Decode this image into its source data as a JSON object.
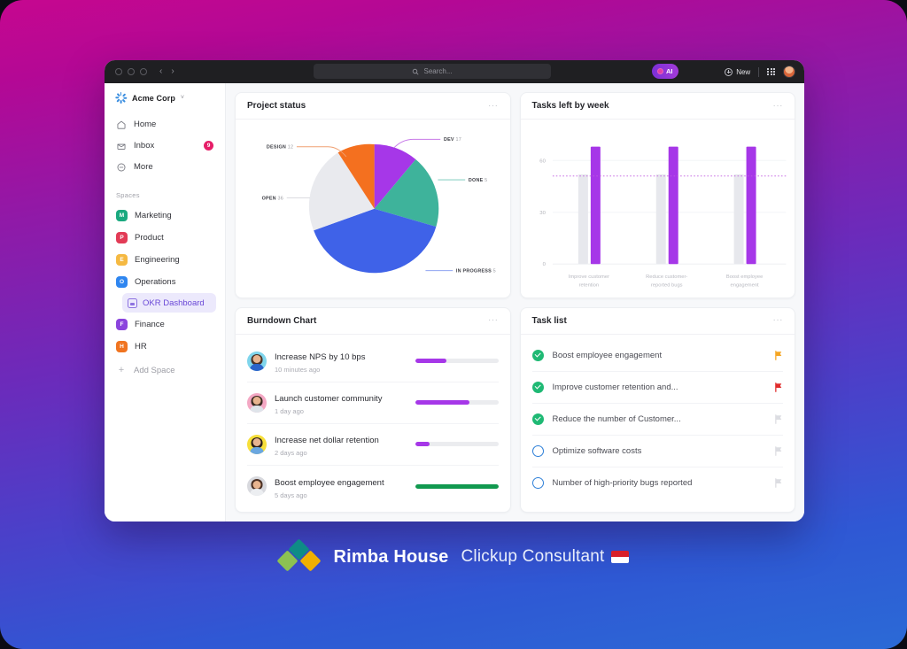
{
  "theme": {
    "bg_top": "#c6078f",
    "bg_mid": "#6b2bbb",
    "bg_bottom": "#2b6ad6",
    "accent_purple": "#a637e8",
    "accent_green": "#1fb974"
  },
  "titlebar": {
    "back_glyph": "‹",
    "forward_glyph": "›",
    "search_placeholder": "Search...",
    "ai_label": "AI",
    "new_label": "New"
  },
  "sidebar": {
    "workspace": "Acme Corp",
    "workspace_caret": "˅",
    "nav": [
      {
        "label": "Home",
        "icon": "home-icon",
        "badge": ""
      },
      {
        "label": "Inbox",
        "icon": "inbox-icon",
        "badge": "9"
      },
      {
        "label": "More",
        "icon": "more-icon",
        "badge": ""
      }
    ],
    "spaces_heading": "Spaces",
    "spaces": [
      {
        "label": "Marketing",
        "initial": "M",
        "color": "#1aa97f"
      },
      {
        "label": "Product",
        "initial": "P",
        "color": "#e23b56"
      },
      {
        "label": "Engineering",
        "initial": "E",
        "color": "#f5b942"
      },
      {
        "label": "Operations",
        "initial": "O",
        "color": "#2f86f0"
      }
    ],
    "sub_item": {
      "label": "OKR Dashboard",
      "icon": "dashboard-icon"
    },
    "spaces_rest": [
      {
        "label": "Finance",
        "initial": "F",
        "color": "#8b44dd"
      },
      {
        "label": "HR",
        "initial": "H",
        "color": "#f07420"
      }
    ],
    "add_space": "Add Space"
  },
  "cards": {
    "project_status": {
      "title": "Project status",
      "menu": "···"
    },
    "tasks_left": {
      "title": "Tasks left by week",
      "menu": "···"
    },
    "burndown": {
      "title": "Burndown Chart",
      "menu": "···"
    },
    "task_list": {
      "title": "Task list",
      "menu": "···"
    }
  },
  "chart_data": [
    {
      "type": "pie",
      "title": "Project status",
      "categories": [
        "DEV",
        "DONE",
        "IN PROGRESS",
        "OPEN",
        "DESIGN"
      ],
      "values": [
        17,
        5,
        5,
        36,
        12
      ],
      "slice_fractions": [
        0.14,
        0.155,
        0.4,
        0.21,
        0.095
      ],
      "colors": [
        "#a637e8",
        "#3eb39b",
        "#3f62e8",
        "#e9eaee",
        "#f4701f"
      ],
      "labels": [
        {
          "name": "DEV",
          "value": "17"
        },
        {
          "name": "DONE",
          "value": "5"
        },
        {
          "name": "IN PROGRESS",
          "value": "5"
        },
        {
          "name": "OPEN",
          "value": "36"
        },
        {
          "name": "DESIGN",
          "value": "12"
        }
      ]
    },
    {
      "type": "bar",
      "title": "Tasks left by week",
      "categories": [
        "Improve customer retention",
        "Reduce customer-reported bugs",
        "Boost employee engagement"
      ],
      "series": [
        {
          "name": "previous",
          "values": [
            52,
            52,
            52
          ],
          "color": "#e7e8ed"
        },
        {
          "name": "current",
          "values": [
            68,
            68,
            68
          ],
          "color": "#a637e8"
        }
      ],
      "ylim": [
        0,
        75
      ],
      "yticks": [
        0,
        30,
        60
      ],
      "ytick_labels": [
        "0",
        "30",
        "60"
      ],
      "target_line": {
        "value": 51,
        "color": "#c05ae0",
        "style": "dotted"
      },
      "xlabel": "",
      "ylabel": "",
      "grid": true,
      "legend": "none"
    }
  ],
  "burndown": {
    "rows": [
      {
        "title": "Increase NPS by 10 bps",
        "time": "10 minutes ago",
        "progress": 38,
        "bar_color": "#a637e8",
        "avatar_bg": "#7fd5ec",
        "hair": "#4a3328",
        "shirt": "#2b63c9"
      },
      {
        "title": "Launch customer community",
        "time": "1 day ago",
        "progress": 65,
        "bar_color": "#a637e8",
        "avatar_bg": "#f4a8c4",
        "hair": "#3a2b22",
        "shirt": "#dfe4ea"
      },
      {
        "title": "Increase net dollar retention",
        "time": "2 days ago",
        "progress": 18,
        "bar_color": "#a637e8",
        "avatar_bg": "#f7df3a",
        "hair": "#2e2118",
        "shirt": "#6aa7e0"
      },
      {
        "title": "Boost employee engagement",
        "time": "5 days ago",
        "progress": 100,
        "bar_color": "#11994f",
        "avatar_bg": "#d8d9de",
        "hair": "#4a3024",
        "shirt": "#eceef1"
      }
    ]
  },
  "task_list": {
    "rows": [
      {
        "label": "Boost employee engagement",
        "state": "done",
        "flag": "#f5a623"
      },
      {
        "label": "Improve customer retention and...",
        "state": "done",
        "flag": "#e02b2b"
      },
      {
        "label": "Reduce the number of Customer...",
        "state": "done",
        "flag": "#dcdde2"
      },
      {
        "label": "Optimize software costs",
        "state": "open",
        "flag": "#dcdde2"
      },
      {
        "label": "Number of high-priority bugs reported",
        "state": "open",
        "flag": "#dcdde2"
      }
    ]
  },
  "footer": {
    "brand": "Rimba House",
    "tagline": "Clickup Consultant",
    "logo_colors": [
      "#0e8c86",
      "#8cc152",
      "#f0b000"
    ],
    "flag": "Indonesia"
  }
}
